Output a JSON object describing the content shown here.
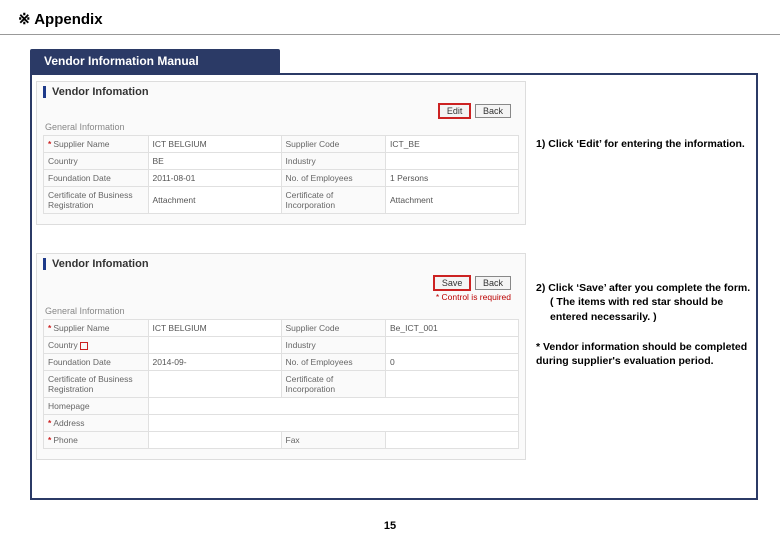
{
  "page": {
    "title_symbol": "※",
    "title": "Appendix",
    "number": "15"
  },
  "section_tab": "Vendor Information Manual",
  "block1": {
    "heading": "Vendor Infomation",
    "sub": "General Information",
    "btn_primary": "Edit",
    "btn_back": "Back",
    "rows": {
      "supplier_name_lbl": "Supplier Name",
      "supplier_name_val": "ICT BELGIUM",
      "supplier_code_lbl": "Supplier Code",
      "supplier_code_val": "ICT_BE",
      "country_lbl": "Country",
      "country_val": "BE",
      "industry_lbl": "Industry",
      "industry_val": "",
      "foundation_lbl": "Foundation Date",
      "foundation_val": "2011-08-01",
      "employees_lbl": "No. of Employees",
      "employees_val": "1 Persons",
      "cert_bus_lbl": "Certificate of Business Registration",
      "cert_inc_lbl": "Certificate of Incorporation",
      "attach": "Attachment"
    }
  },
  "block2": {
    "heading": "Vendor Infomation",
    "sub": "General Information",
    "btn_primary": "Save",
    "btn_back": "Back",
    "req_note": "* Control is required",
    "rows": {
      "supplier_name_lbl": "Supplier Name",
      "supplier_name_val": "ICT BELGIUM",
      "supplier_code_lbl": "Supplier Code",
      "supplier_code_val": "Be_ICT_001",
      "country_lbl": "Country",
      "country_val": "",
      "industry_lbl": "Industry",
      "industry_val": "",
      "foundation_lbl": "Foundation Date",
      "foundation_val": "2014-09-",
      "employees_lbl": "No. of Employees",
      "employees_val": "0",
      "cert_bus_lbl": "Certificate of Business Registration",
      "cert_inc_lbl": "Certificate of Incorporation",
      "homepage_lbl": "Homepage",
      "address_lbl": "Address",
      "phone_lbl": "Phone",
      "fax_lbl": "Fax"
    }
  },
  "instructions": {
    "i1": "1)  Click ‘Edit’ for entering the information.",
    "i2a": "2)  Click ‘Save’ after you complete the form.",
    "i2b": "( The items with red star should be entered necessarily. )",
    "note": "* Vendor information should be completed during supplier's evaluation period."
  }
}
